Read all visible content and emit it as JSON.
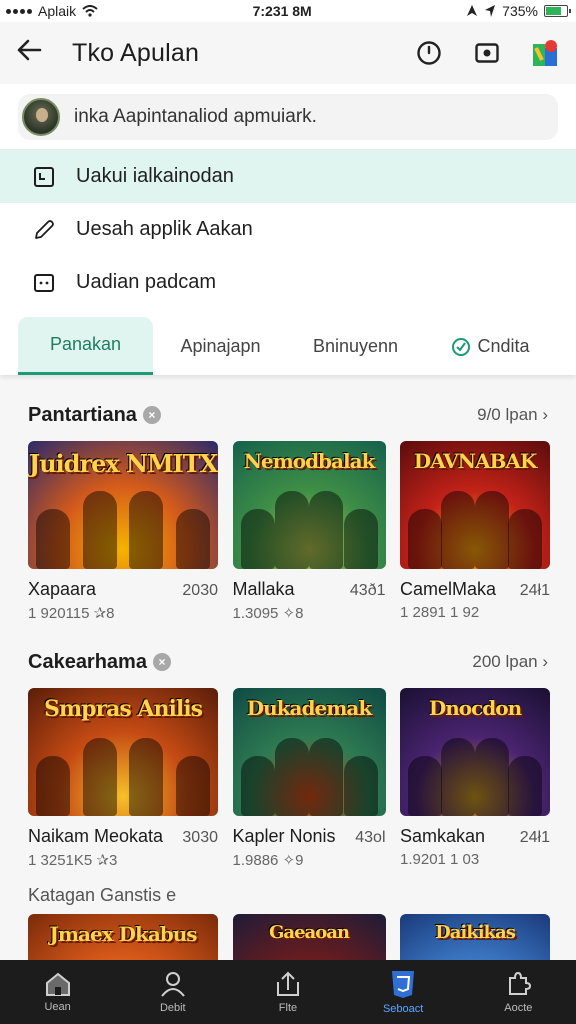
{
  "status_bar": {
    "carrier": "Aplaik",
    "time": "7:231 8M",
    "battery_text": "735%"
  },
  "app_bar": {
    "title": "Tko Apulan"
  },
  "search": {
    "placeholder": "inka Aapintanaliod apmuiark."
  },
  "menu": [
    {
      "label": "Uakui ialkainodan",
      "icon": "calendar-icon",
      "active": true
    },
    {
      "label": "Uesah applik Aakan",
      "icon": "pencil-icon",
      "active": false
    },
    {
      "label": "Uadian padcam",
      "icon": "square-icon",
      "active": false
    }
  ],
  "tabs": [
    {
      "label": "Panakan",
      "selected": true
    },
    {
      "label": "Apinajapn",
      "selected": false
    },
    {
      "label": "Bninuyenn",
      "selected": false
    },
    {
      "label": "Cndita",
      "selected": false,
      "icon": "check-circle-icon"
    }
  ],
  "sections": [
    {
      "title": "Pantartiana",
      "more": "9/0 lpan ›",
      "cards": [
        {
          "thumb_title": "Juidrex NMITX",
          "name": "Xapaara",
          "count": "2030",
          "sub": "1 920115 ✰8",
          "colors": [
            "#2a2a6a",
            "#d45a1b",
            "#f6b400"
          ]
        },
        {
          "thumb_title": "Nemodbalak",
          "name": "Mallaka",
          "count": "43ð1",
          "sub": "1.3095 ✧8",
          "colors": [
            "#15604d",
            "#3e8e46",
            "#b0c24f"
          ]
        },
        {
          "thumb_title": "DAVNABAK",
          "name": "CamelMaka",
          "count": "24ł1",
          "sub": "1 2891 1 92",
          "colors": [
            "#5a0c0c",
            "#c22218",
            "#f7a10f"
          ]
        }
      ]
    },
    {
      "title": "Cakearhama",
      "more": "200 lpan ›",
      "cards": [
        {
          "thumb_title": "Smpras Anilis",
          "name": "Naikam Meokata",
          "count": "3030",
          "sub": "1 3251K5 ✰3",
          "colors": [
            "#5a1d0a",
            "#c54b14",
            "#f7c02b"
          ]
        },
        {
          "thumb_title": "Dukademak",
          "name": "Kapler Nonis",
          "count": "43ol",
          "sub": "1.9886 ✧9",
          "colors": [
            "#0f4a44",
            "#2e7a52",
            "#d04a1a"
          ]
        },
        {
          "thumb_title": "Dnocdon",
          "name": "Samkakan",
          "count": "24ł1",
          "sub": "1.9201 1 03",
          "colors": [
            "#1a1033",
            "#4a2470",
            "#c9971e"
          ]
        }
      ]
    }
  ],
  "third_section": {
    "title": "Katagan Ganstis e",
    "cards": [
      {
        "thumb_title": "Jmaex Dkabus",
        "colors": [
          "#7a2a0a",
          "#d8591a",
          "#f5c12c"
        ]
      },
      {
        "thumb_title": "Gaeaoan",
        "colors": [
          "#1e1b38",
          "#6c1d1d",
          "#d8a42a"
        ]
      },
      {
        "thumb_title": "Daikikas",
        "colors": [
          "#1a3a7a",
          "#3d7ac7",
          "#f2c63a"
        ]
      }
    ]
  },
  "bottom_nav": [
    {
      "label": "Uean",
      "icon": "home-icon",
      "selected": false
    },
    {
      "label": "Debit",
      "icon": "person-icon",
      "selected": false
    },
    {
      "label": "Flte",
      "icon": "upload-icon",
      "selected": false
    },
    {
      "label": "Seboact",
      "icon": "css-shield-icon",
      "selected": true
    },
    {
      "label": "Aocte",
      "icon": "puzzle-icon",
      "selected": false
    }
  ],
  "theme": {
    "accent": "#1a9a75",
    "accent_bg": "#e0f5ef",
    "nav_bg": "#1c1c1c",
    "nav_selected": "#5aa7ff"
  }
}
